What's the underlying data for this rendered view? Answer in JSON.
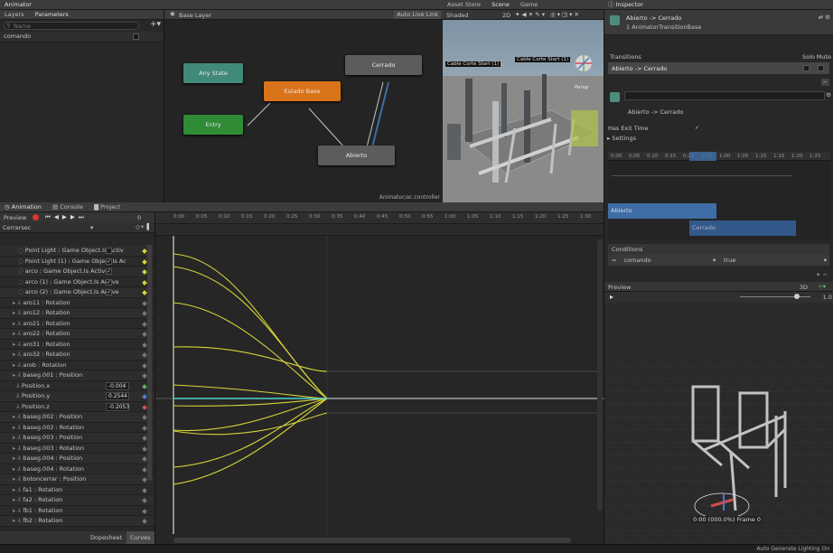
{
  "animator": {
    "tab_label": "Animator",
    "subtabs": [
      "Layers",
      "Parameters"
    ],
    "search_placeholder": "Name",
    "parameter": "comando",
    "layer_label": "Base Layer",
    "auto_live_link": "Auto Live Link",
    "controller_path": "Animator/ac.controller",
    "states": {
      "any": "Any State",
      "entry": "Entry",
      "base": "Estado Base",
      "cerrado": "Cerrado",
      "abierto": "Abierto"
    }
  },
  "scene": {
    "tabs": [
      "Asset Store",
      "Scene",
      "Game"
    ],
    "mode": "Shaded",
    "mode_2d": "2D",
    "label_1": "Cable Corte Start (1)",
    "label_2": "Cable Corte Start (1)",
    "persp": "Persp"
  },
  "inspector": {
    "tab_label": "Inspector",
    "title": "Abierto -> Cerrado",
    "subtitle": "1 AnimatorTransitionBase",
    "transitions_label": "Transitions",
    "solo_label": "Solo",
    "mute_label": "Mute",
    "transition_item": "Abierto -> Cerrado",
    "transition_name": "Abierto -> Cerrado",
    "has_exit_time_label": "Has Exit Time",
    "settings_label": "Settings",
    "timeline_ticks": [
      "0:00",
      "0:05",
      "0:10",
      "0:15",
      "0:20",
      "0:25",
      "1:00",
      "1:05",
      "1:10",
      "1:15",
      "1:20",
      "1:25"
    ],
    "bar_from": "Abierto",
    "bar_to": "Cerrado",
    "conditions_label": "Conditions",
    "condition_param": "comando",
    "condition_value": "true",
    "preview_label": "Preview",
    "preview_mode": "3D",
    "preview_speed": "1.0",
    "preview_time": "0:00 (000.0%) Frame 0"
  },
  "animation": {
    "tabs": [
      "Animation",
      "Console",
      "Project"
    ],
    "preview_label": "Preview",
    "frame": "0",
    "clip": "Cerrarsec",
    "tracks": [
      {
        "label": "Point Light : Game Object.Is Activ",
        "check": ""
      },
      {
        "label": "Point Light (1) : Game Object.Is Ac",
        "check": "✓"
      },
      {
        "label": "arco : Game Object.Is Active",
        "check": "✓"
      },
      {
        "label": "arco (1) : Game Object.Is Active",
        "check": "✓"
      },
      {
        "label": "arco (2) : Game Object.Is Active",
        "check": "✓"
      },
      {
        "label": "aro11 : Rotation"
      },
      {
        "label": "aro12 : Rotation"
      },
      {
        "label": "aro21 : Rotation"
      },
      {
        "label": "aro22 : Rotation"
      },
      {
        "label": "aro31 : Rotation"
      },
      {
        "label": "aro32 : Rotation"
      },
      {
        "label": "arob : Rotation"
      },
      {
        "label": "baseg.001 : Position"
      },
      {
        "label": "Position.x",
        "value": "-0.004"
      },
      {
        "label": "Position.y",
        "value": "0.2544"
      },
      {
        "label": "Position.z",
        "value": "-0.2053"
      },
      {
        "label": "baseg.002 : Position"
      },
      {
        "label": "baseg.002 : Rotation"
      },
      {
        "label": "baseg.003 : Position"
      },
      {
        "label": "baseg.003 : Rotation"
      },
      {
        "label": "baseg.004 : Position"
      },
      {
        "label": "baseg.004 : Rotation"
      },
      {
        "label": "botoncerrar : Position"
      },
      {
        "label": "fa1 : Rotation"
      },
      {
        "label": "fa2 : Rotation"
      },
      {
        "label": "fb1 : Rotation"
      },
      {
        "label": "fb2 : Rotation"
      }
    ],
    "ruler_ticks": [
      "0:00",
      "0:05",
      "0:10",
      "0:15",
      "0:20",
      "0:25",
      "0:30",
      "0:35",
      "0:40",
      "0:45",
      "0:50",
      "0:55",
      "1:00",
      "1:05",
      "1:10",
      "1:15",
      "1:20",
      "1:25",
      "1:30"
    ],
    "dopesheet": "Dopesheet",
    "curves": "Curves"
  },
  "status": {
    "right": "Auto Generate Lighting On"
  },
  "colors": {
    "state_orange": "#d9741b",
    "state_green": "#2f8b35",
    "state_teal": "#418a79",
    "state_gray": "#5c5c5c",
    "transition_blue": "#3e6ea5",
    "curve_yellow": "#d6d43a"
  }
}
